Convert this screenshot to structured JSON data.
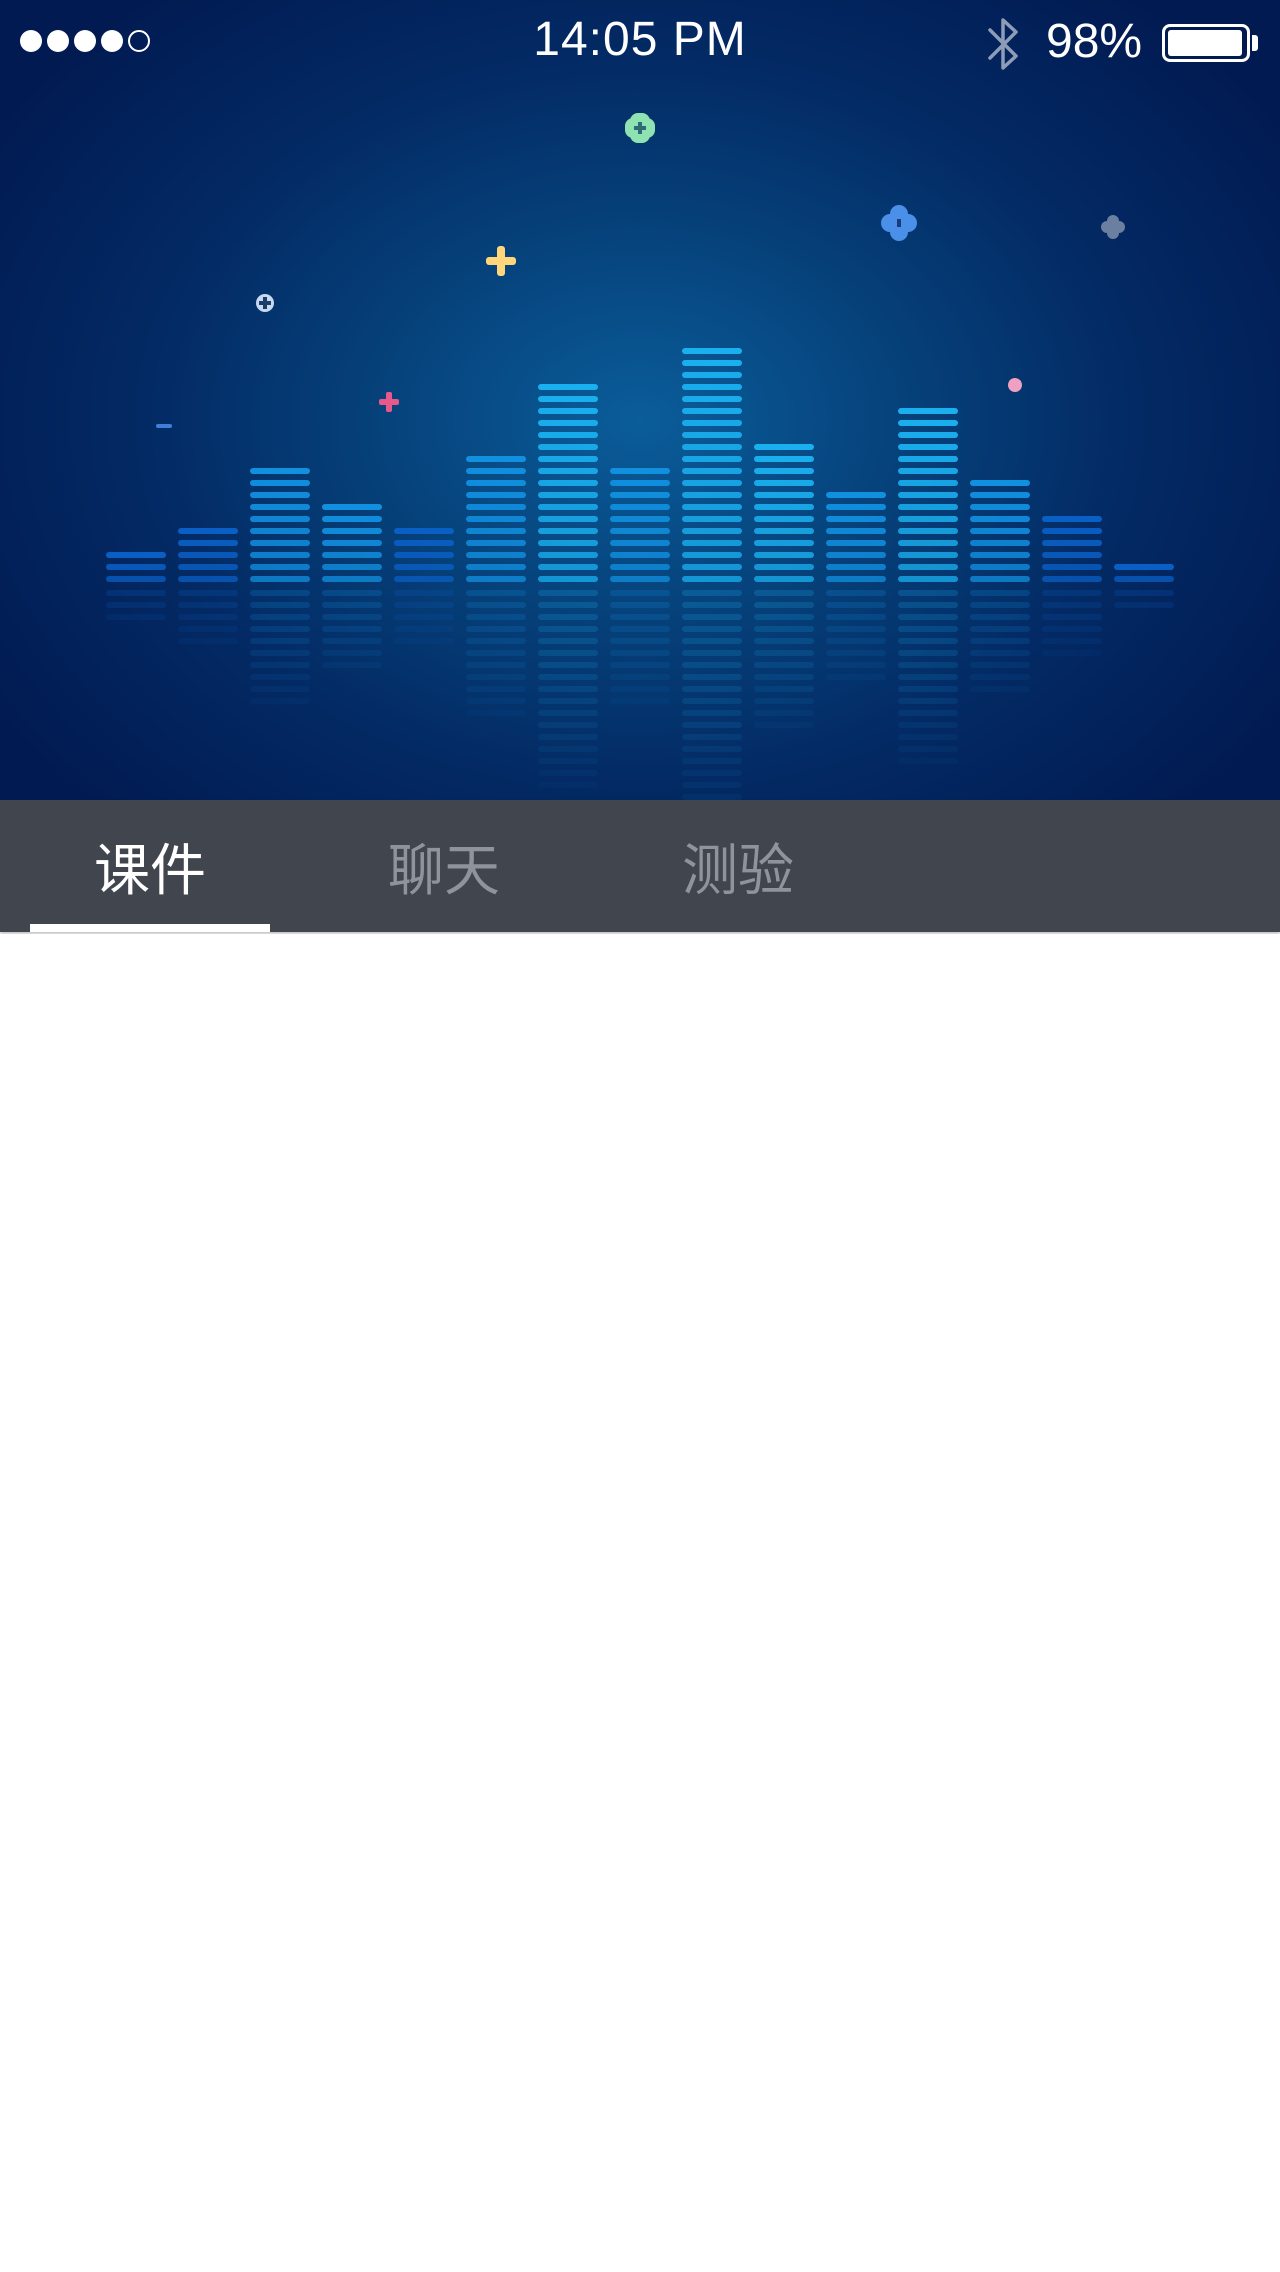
{
  "status_bar": {
    "signal_bars": [
      true,
      true,
      true,
      true,
      false
    ],
    "time": "14:05 PM",
    "bluetooth_icon": "bluetooth-icon",
    "battery_percent": "98%",
    "battery_level": 0.98
  },
  "hero": {
    "graphic": "audio-equalizer-illustration",
    "bar_levels": [
      3,
      5,
      10,
      7,
      5,
      11,
      17,
      10,
      20,
      12,
      8,
      15,
      9,
      6,
      2
    ],
    "colors": {
      "bar_bright": "#1ab0f0",
      "bar_dim": "#0a5fc4",
      "bg": "#032a64"
    },
    "sparkles": [
      "green-plus",
      "yellow-plus",
      "blue-clover",
      "gray-clover",
      "pink-dot",
      "pink-plus",
      "white-plus",
      "blue-dash"
    ]
  },
  "tabs": [
    {
      "label": "课件",
      "active": true
    },
    {
      "label": "聊天",
      "active": false
    },
    {
      "label": "测验",
      "active": false
    }
  ],
  "theme": {
    "tabbar_bg": "#41454d",
    "tab_active": "#ffffff",
    "tab_inactive": "#8e939c"
  }
}
